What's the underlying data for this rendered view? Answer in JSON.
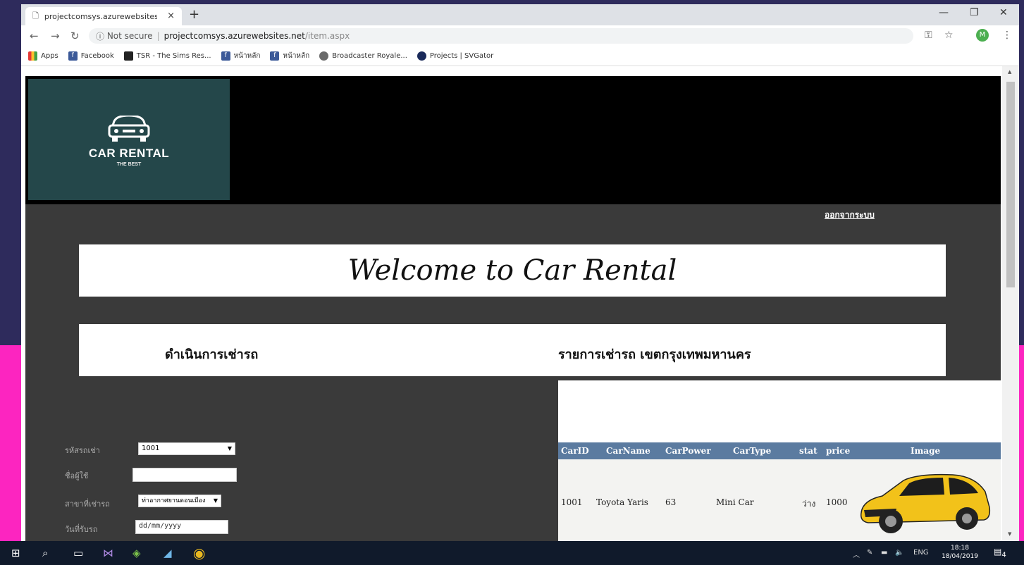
{
  "browser": {
    "tab_title": "projectcomsys.azurewebsites.net",
    "tab_close": "×",
    "new_tab": "+",
    "window_min": "—",
    "window_max": "❐",
    "window_close": "✕",
    "address": {
      "security": "Not secure",
      "separator": "|",
      "host": "projectcomsys.azurewebsites.net",
      "path": "/item.aspx"
    },
    "bookmarks": [
      {
        "label": "Apps",
        "icon": "apps-grid-icon"
      },
      {
        "label": "Facebook",
        "icon": "facebook-icon"
      },
      {
        "label": "TSR - The Sims Res...",
        "icon": "tsr-icon"
      },
      {
        "label": "หน้าหลัก",
        "icon": "facebook-icon"
      },
      {
        "label": "หน้าหลัก",
        "icon": "facebook-icon"
      },
      {
        "label": "Broadcaster Royale...",
        "icon": "broadcaster-icon"
      },
      {
        "label": "Projects | SVGator",
        "icon": "svgator-icon"
      }
    ],
    "avatar_letter": "M"
  },
  "page": {
    "logo_title": "CAR RENTAL",
    "logo_subtitle": "THE BEST",
    "logout_link": "ออกจากระบบ",
    "welcome": "Welcome to Car Rental",
    "section_left": "ดำเนินการเช่ารถ",
    "section_right": "รายการเช่ารถ เขตกรุงเทพมหานคร"
  },
  "form": {
    "car_id_label": "รหัสรถเช่า",
    "car_id_value": "1001",
    "user_label": "ชื่อผู้ใช้",
    "user_value": "",
    "branch_label": "สาขาที่เช่ารถ",
    "branch_value": "ท่าอากาศยานดอนเมือง",
    "pickup_label": "วันที่รับรถ",
    "pickup_value": "dd/mm/yyyy"
  },
  "grid": {
    "columns": [
      "CarID",
      "CarName",
      "CarPower",
      "CarType",
      "stat",
      "price",
      "Image"
    ],
    "rows": [
      {
        "CarID": "1001",
        "CarName": "Toyota Yaris",
        "CarPower": "63",
        "CarType": "Mini Car",
        "stat": "ว่าง",
        "price": "1000"
      }
    ]
  },
  "taskbar": {
    "lang": "ENG",
    "time": "18:18",
    "date": "18/04/2019",
    "notif_count": "4"
  }
}
